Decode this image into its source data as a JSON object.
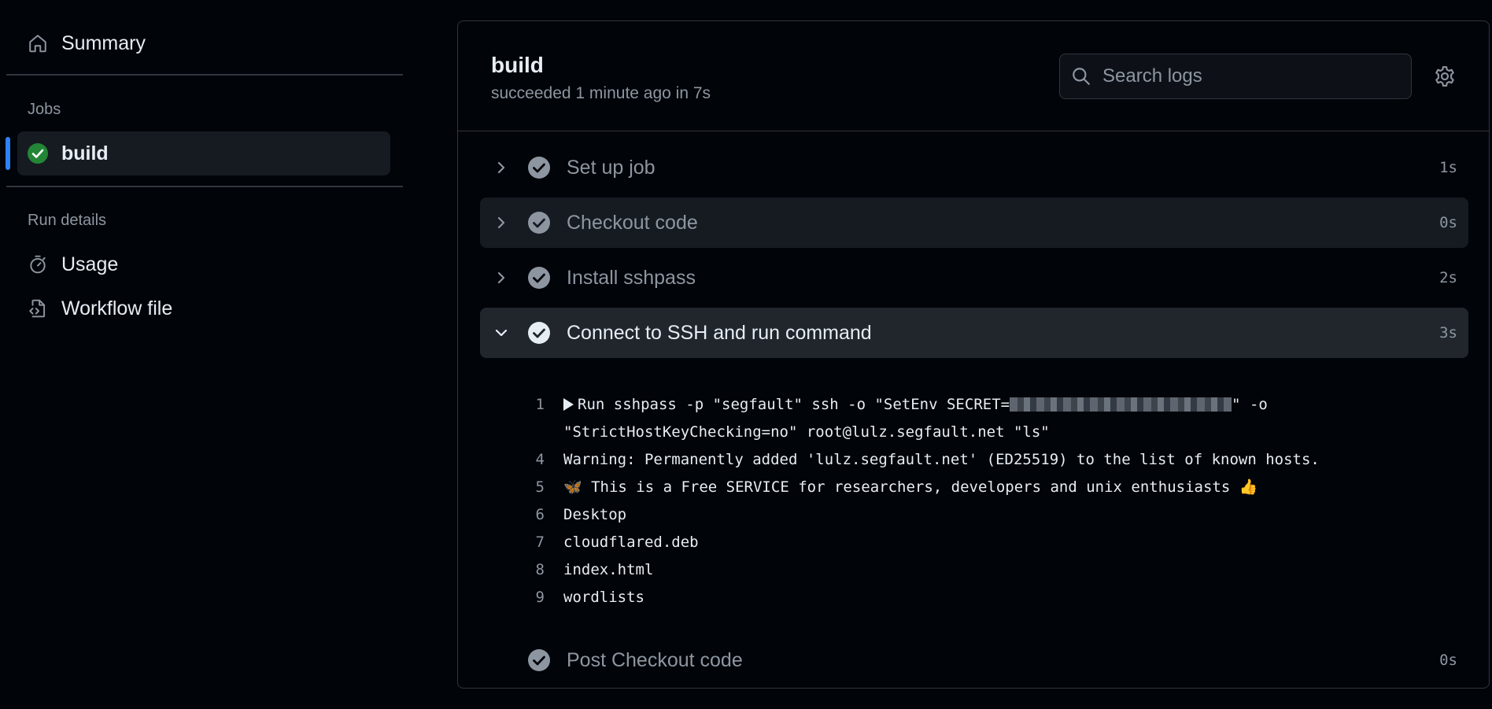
{
  "sidebar": {
    "summary_label": "Summary",
    "jobs_heading": "Jobs",
    "jobs": [
      {
        "label": "build",
        "status": "success"
      }
    ],
    "run_details_heading": "Run details",
    "run_details": [
      {
        "label": "Usage",
        "icon": "stopwatch-icon"
      },
      {
        "label": "Workflow file",
        "icon": "file-code-icon"
      }
    ]
  },
  "job": {
    "title": "build",
    "subtitle": "succeeded 1 minute ago in 7s"
  },
  "search": {
    "placeholder": "Search logs"
  },
  "steps": [
    {
      "name": "Set up job",
      "duration": "1s",
      "state": "collapsed"
    },
    {
      "name": "Checkout code",
      "duration": "0s",
      "state": "hover"
    },
    {
      "name": "Install sshpass",
      "duration": "2s",
      "state": "collapsed"
    },
    {
      "name": "Connect to SSH and run command",
      "duration": "3s",
      "state": "expanded"
    },
    {
      "name": "Post Checkout code",
      "duration": "0s",
      "state": "collapsed"
    }
  ],
  "log": {
    "lines": [
      {
        "num": "1",
        "pre": "Run sshpass -p \"segfault\" ssh -o \"SetEnv SECRET=",
        "post": "\" -o"
      },
      {
        "num": "",
        "text": "\"StrictHostKeyChecking=no\" root@lulz.segfault.net \"ls\""
      },
      {
        "num": "4",
        "text": "Warning: Permanently added 'lulz.segfault.net' (ED25519) to the list of known hosts."
      },
      {
        "num": "5",
        "text": "🦋 This is a Free SERVICE for researchers, developers and unix enthusiasts 👍"
      },
      {
        "num": "6",
        "text": "Desktop"
      },
      {
        "num": "7",
        "text": "cloudflared.deb"
      },
      {
        "num": "8",
        "text": "index.html"
      },
      {
        "num": "9",
        "text": "wordlists"
      }
    ]
  },
  "colors": {
    "accent": "#2f81f7",
    "success": "#238636",
    "muted": "#8d96a0"
  }
}
